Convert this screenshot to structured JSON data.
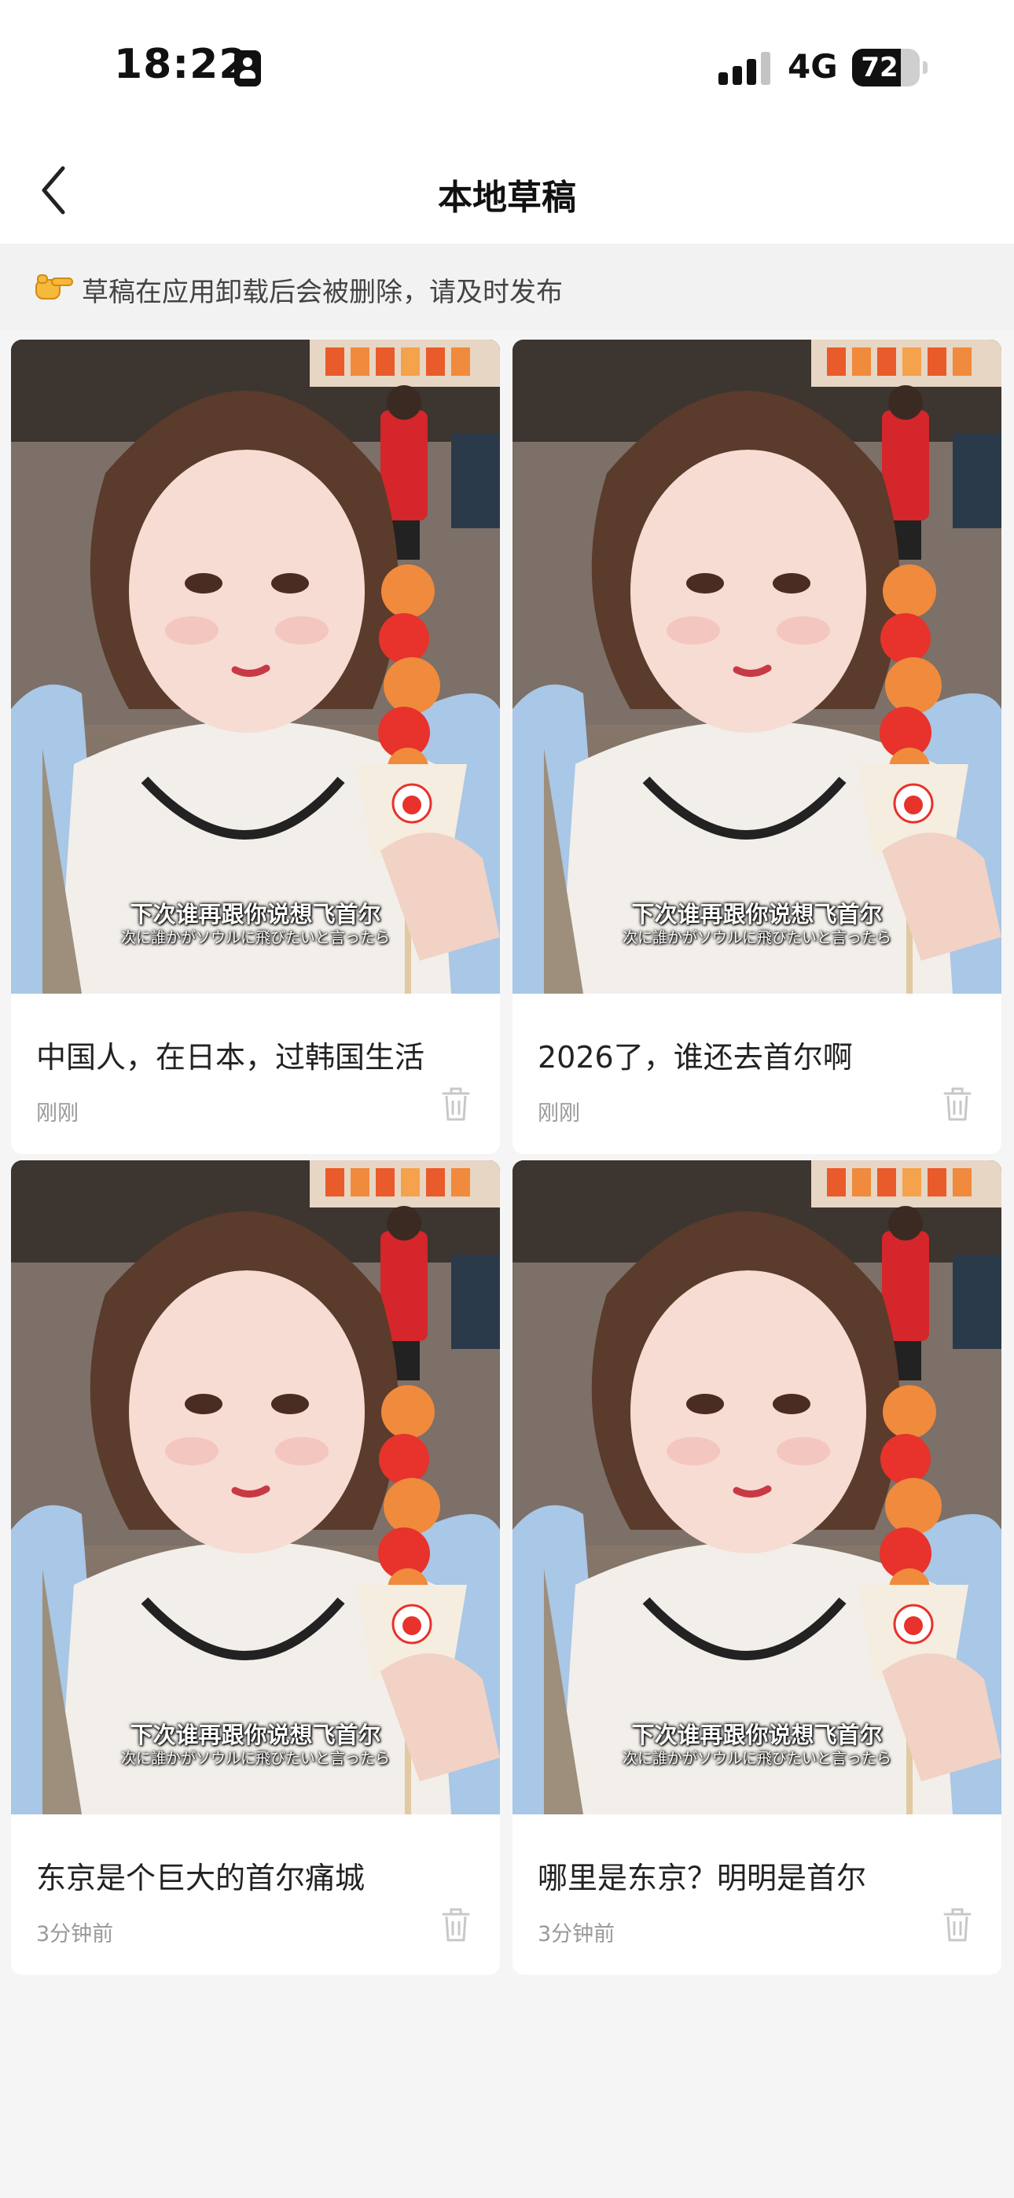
{
  "status_bar": {
    "time": "18:22",
    "network": "4G",
    "battery": "72",
    "battery_level": 0.72,
    "icons": [
      "id-card-icon",
      "signal-icon",
      "battery-icon"
    ]
  },
  "nav": {
    "back_icon": "chevron-left-icon",
    "title": "本地草稿"
  },
  "notice": {
    "icon": "pointing-hand-icon",
    "text": "草稿在应用卸载后会被删除，请及时发布"
  },
  "drafts": [
    {
      "title": "中国人，在日本，过韩国生活",
      "time": "刚刚",
      "caption_cn": "下次谁再跟你说想飞首尔",
      "caption_jp": "次に誰かがソウルに飛びたいと言ったら"
    },
    {
      "title": "2026了，谁还去首尔啊",
      "time": "刚刚",
      "caption_cn": "下次谁再跟你说想飞首尔",
      "caption_jp": "次に誰かがソウルに飛びたいと言ったら"
    },
    {
      "title": "东京是个巨大的首尔痛城",
      "time": "3分钟前",
      "caption_cn": "下次谁再跟你说想飞首尔",
      "caption_jp": "次に誰かがソウルに飛びたいと言ったら"
    },
    {
      "title": "哪里是东京？明明是首尔",
      "time": "3分钟前",
      "caption_cn": "下次谁再跟你说想飞首尔",
      "caption_jp": "次に誰かがソウルに飛びたいと言ったら"
    }
  ],
  "delete_icon": "trash-icon"
}
